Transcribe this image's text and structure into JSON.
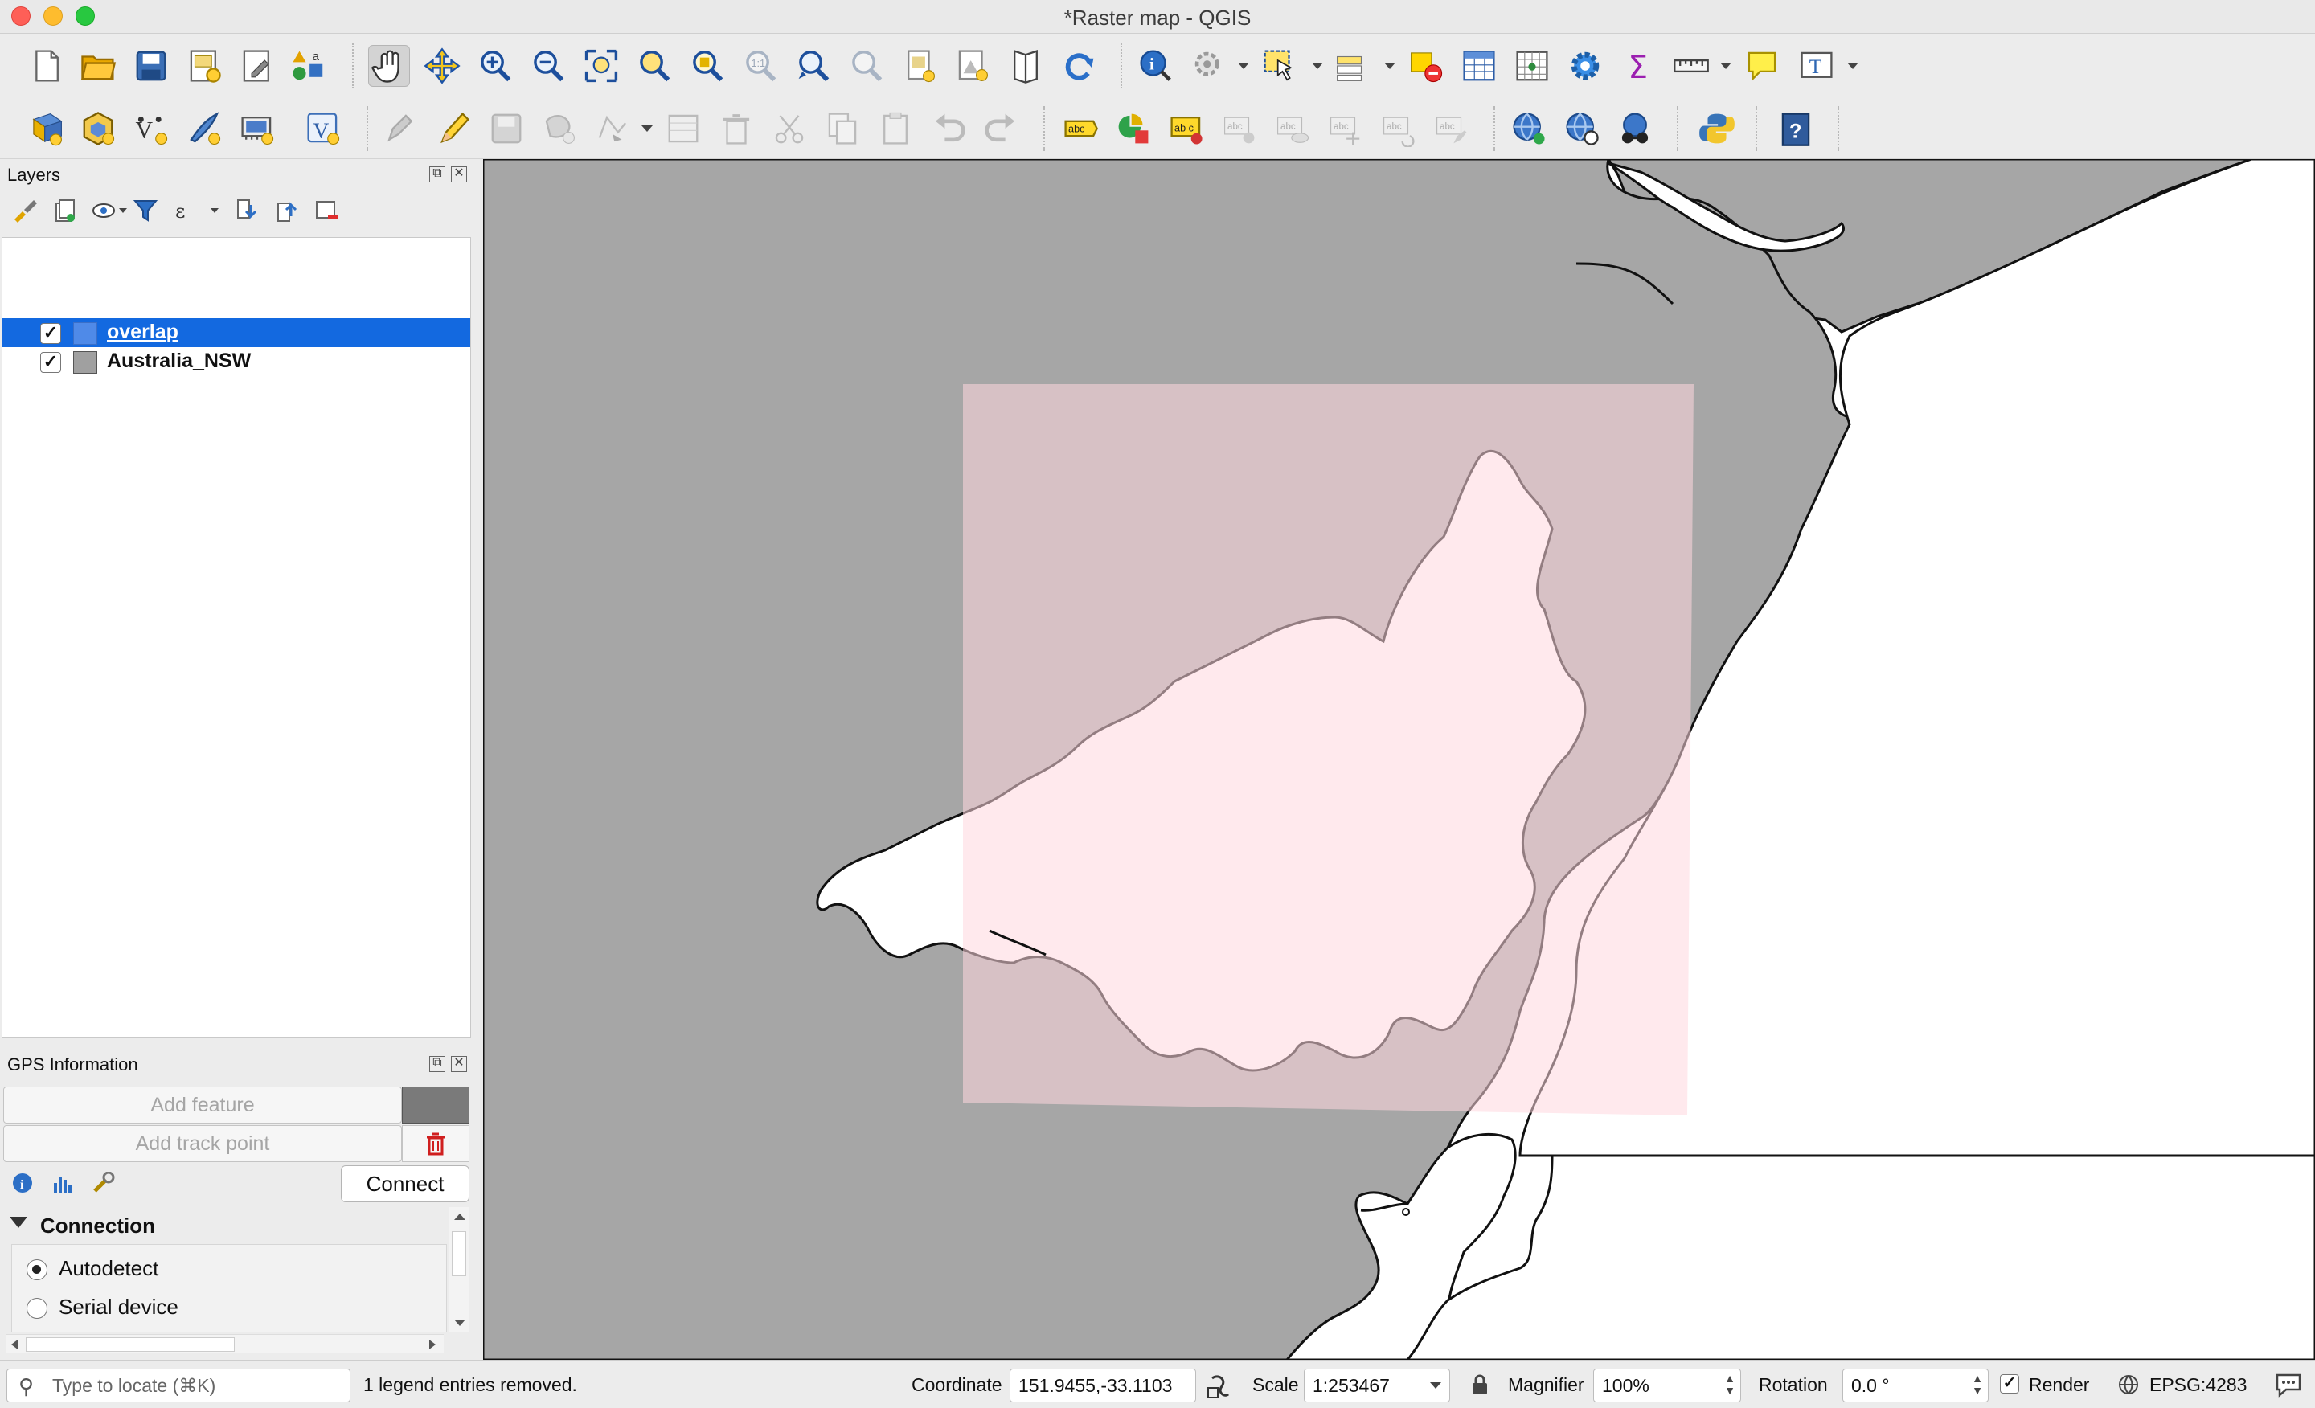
{
  "window": {
    "title": "*Raster map - QGIS"
  },
  "colors": {
    "accent": "#1369e0",
    "land": "#a6a6a6",
    "overlap_fill": "#ffd7df",
    "sea": "#ffffff"
  },
  "toolbar_icons": [
    "new-project-icon",
    "open-project-icon",
    "save-project-icon",
    "new-print-layout-icon",
    "layout-manager-icon",
    "style-manager-icon",
    "pan-map-icon",
    "pan-to-selection-icon",
    "zoom-in-icon",
    "zoom-out-icon",
    "zoom-full-icon",
    "zoom-to-selection-icon",
    "zoom-to-layer-icon",
    "zoom-native-icon",
    "zoom-last-icon",
    "zoom-next-icon",
    "new-map-view-icon",
    "new-3d-view-icon",
    "temporal-controller-icon",
    "refresh-icon",
    "identify-features-icon",
    "run-action-icon",
    "select-features-icon",
    "select-by-value-icon",
    "deselect-icon",
    "attribute-table-icon",
    "field-calculator-icon",
    "processing-toolbox-icon",
    "statistics-icon",
    "measure-icon",
    "map-tips-icon",
    "text-annotation-icon"
  ],
  "layers_panel": {
    "title": "Layers",
    "layers": [
      {
        "name": "overlap",
        "checked": true,
        "selected": true,
        "swatch": "#4f8ae8"
      },
      {
        "name": "Australia_NSW",
        "checked": true,
        "selected": false,
        "swatch": "#a0a0a0"
      }
    ]
  },
  "gps_panel": {
    "title": "GPS Information",
    "add_feature": "Add feature",
    "add_track_point": "Add track point",
    "connect": "Connect",
    "connection": "Connection",
    "options": [
      {
        "label": "Autodetect",
        "selected": true
      },
      {
        "label": "Serial device",
        "selected": false
      }
    ]
  },
  "status": {
    "locate_placeholder": "Type to locate (⌘K)",
    "message": "1 legend entries removed.",
    "coordinate_label": "Coordinate",
    "coordinate": "151.9455,-33.1103",
    "scale_label": "Scale",
    "scale": "1:253467",
    "magnifier_label": "Magnifier",
    "magnifier": "100%",
    "rotation_label": "Rotation",
    "rotation": "0.0 °",
    "render_label": "Render",
    "crs": "EPSG:4283"
  }
}
